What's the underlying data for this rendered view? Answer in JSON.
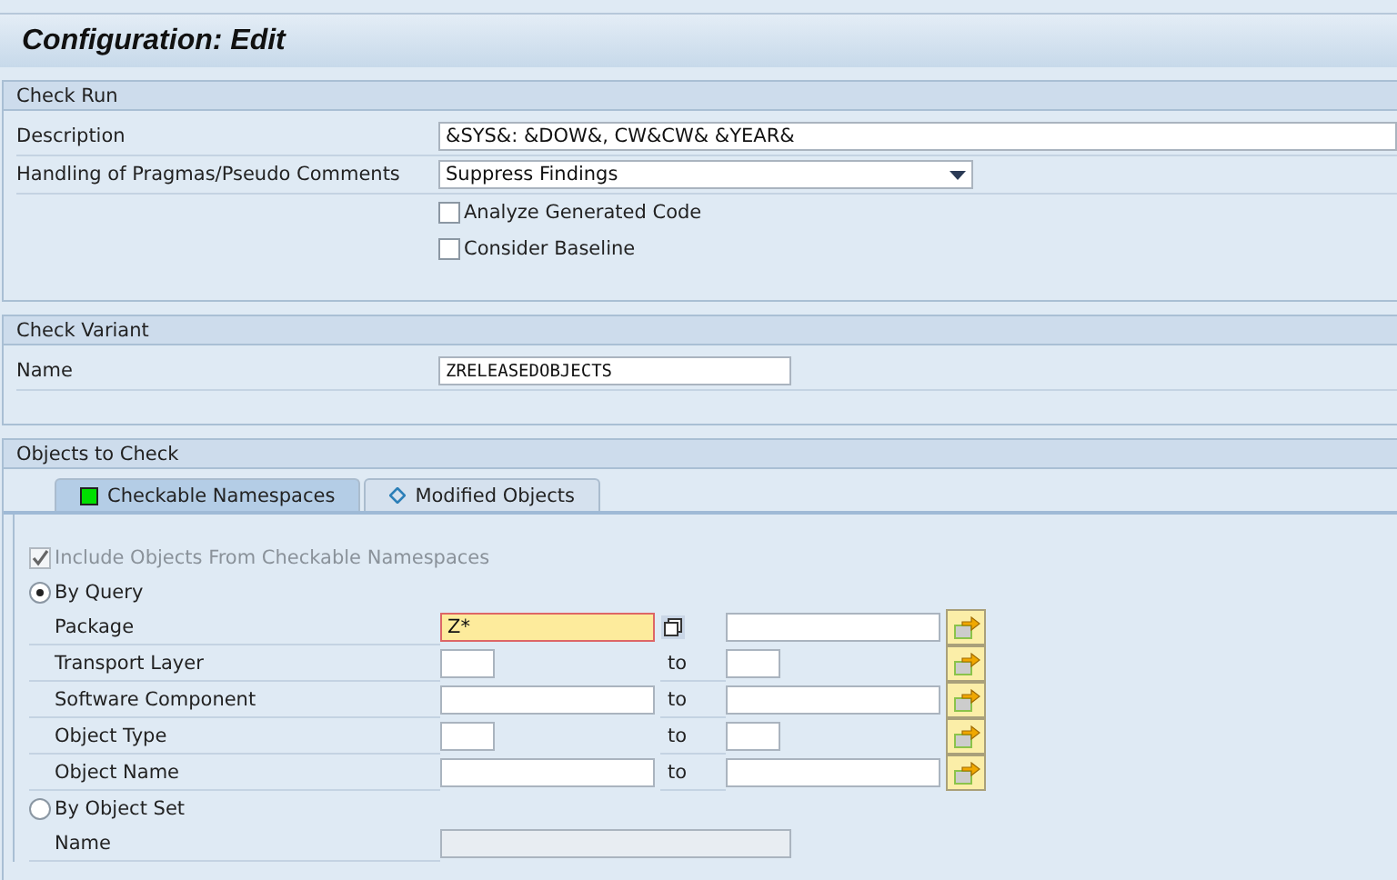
{
  "window": {
    "title": "Configuration: Edit"
  },
  "check_run": {
    "heading": "Check Run",
    "description": {
      "label": "Description",
      "value": "&SYS&: &DOW&, CW&CW& &YEAR&"
    },
    "pragmas": {
      "label": "Handling of Pragmas/Pseudo Comments",
      "value": "Suppress Findings"
    },
    "options": [
      {
        "label": "Analyze Generated Code",
        "checked": false
      },
      {
        "label": "Consider Baseline",
        "checked": false
      }
    ]
  },
  "check_variant": {
    "heading": "Check Variant",
    "name": {
      "label": "Name",
      "value": "ZRELEASEDOBJECTS"
    }
  },
  "objects": {
    "heading": "Objects to Check",
    "tabs": [
      {
        "label": "Checkable Namespaces",
        "selected": true,
        "kind": "square"
      },
      {
        "label": "Modified Objects",
        "selected": false,
        "kind": "diamond"
      }
    ],
    "include": {
      "label": "Include Objects From Checkable Namespaces",
      "checked": true,
      "disabled": true
    },
    "by_query": {
      "label": "By Query",
      "selected": true
    },
    "query_fields": [
      {
        "label": "Package",
        "kind": "multi",
        "narrow": false,
        "low": "Z*",
        "required": true
      },
      {
        "label": "Transport Layer",
        "kind": "range",
        "narrow": true,
        "to": "to",
        "required": false
      },
      {
        "label": "Software Component",
        "kind": "range",
        "narrow": false,
        "to": "to",
        "required": false
      },
      {
        "label": "Object Type",
        "kind": "range",
        "narrow": true,
        "to": "to",
        "required": false
      },
      {
        "label": "Object Name",
        "kind": "range",
        "narrow": false,
        "to": "to",
        "required": false
      }
    ],
    "by_object_set": {
      "label": "By Object Set",
      "selected": false
    },
    "set_name": {
      "label": "Name",
      "disabled": true
    }
  }
}
